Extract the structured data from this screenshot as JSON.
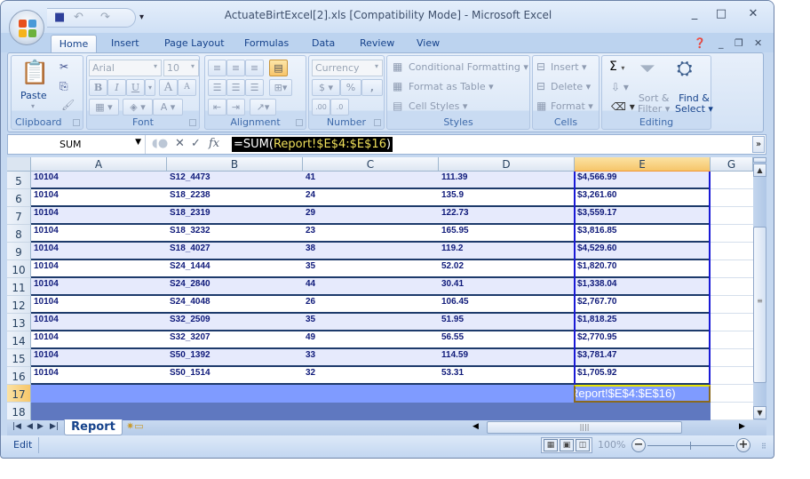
{
  "window": {
    "title": "ActuateBirtExcel[2].xls  [Compatibility Mode] - Microsoft Excel",
    "minimize_glyph": "_",
    "maximize_glyph": "□",
    "close_glyph": "✕"
  },
  "qat": {
    "save_icon": "save-icon",
    "undo_glyph": "↶",
    "redo_glyph": "↷",
    "customize_glyph": "⇟"
  },
  "tabs": [
    "Home",
    "Insert",
    "Page Layout",
    "Formulas",
    "Data",
    "Review",
    "View"
  ],
  "tabs_active": "Home",
  "ribbon": {
    "clipboard": {
      "label": "Clipboard",
      "paste": "Paste"
    },
    "font": {
      "label": "Font",
      "font_name": "Arial",
      "font_size": "10",
      "bold": "B",
      "italic": "I",
      "underline": "U",
      "grow": "A",
      "shrink": "A",
      "font_color": "A"
    },
    "alignment": {
      "label": "Alignment"
    },
    "number": {
      "label": "Number",
      "format": "Currency",
      "currency": "$",
      "percent": "%",
      "comma": ",",
      "inc_decimal": ".00",
      "dec_decimal": ".0"
    },
    "styles": {
      "label": "Styles",
      "conditional": "Conditional Formatting",
      "format_table": "Format as Table",
      "cell_styles": "Cell Styles"
    },
    "cells": {
      "label": "Cells",
      "insert": "Insert",
      "delete": "Delete",
      "format": "Format"
    },
    "editing": {
      "label": "Editing",
      "sum": "Σ",
      "sort_filter_1": "Sort &",
      "sort_filter_2": "Filter",
      "find_select_1": "Find &",
      "find_select_2": "Select"
    }
  },
  "formula_bar": {
    "name_box": "SUM",
    "formula_prefix": "=SUM(",
    "formula_ref": "Report!$E$4:$E$16",
    "formula_suffix": ")"
  },
  "columns": [
    "A",
    "B",
    "C",
    "D",
    "E",
    "G"
  ],
  "selected_column": "E",
  "rows": [
    {
      "num": "5",
      "a": "10104",
      "b": "S12_4473",
      "c": "41",
      "d": "111.39",
      "e": "$4,566.99"
    },
    {
      "num": "6",
      "a": "10104",
      "b": "S18_2238",
      "c": "24",
      "d": "135.9",
      "e": "$3,261.60"
    },
    {
      "num": "7",
      "a": "10104",
      "b": "S18_2319",
      "c": "29",
      "d": "122.73",
      "e": "$3,559.17"
    },
    {
      "num": "8",
      "a": "10104",
      "b": "S18_3232",
      "c": "23",
      "d": "165.95",
      "e": "$3,816.85"
    },
    {
      "num": "9",
      "a": "10104",
      "b": "S18_4027",
      "c": "38",
      "d": "119.2",
      "e": "$4,529.60"
    },
    {
      "num": "10",
      "a": "10104",
      "b": "S24_1444",
      "c": "35",
      "d": "52.02",
      "e": "$1,820.70"
    },
    {
      "num": "11",
      "a": "10104",
      "b": "S24_2840",
      "c": "44",
      "d": "30.41",
      "e": "$1,338.04"
    },
    {
      "num": "12",
      "a": "10104",
      "b": "S24_4048",
      "c": "26",
      "d": "106.45",
      "e": "$2,767.70"
    },
    {
      "num": "13",
      "a": "10104",
      "b": "S32_2509",
      "c": "35",
      "d": "51.95",
      "e": "$1,818.25"
    },
    {
      "num": "14",
      "a": "10104",
      "b": "S32_3207",
      "c": "49",
      "d": "56.55",
      "e": "$2,770.95"
    },
    {
      "num": "15",
      "a": "10104",
      "b": "S50_1392",
      "c": "33",
      "d": "114.59",
      "e": "$3,781.47"
    },
    {
      "num": "16",
      "a": "10104",
      "b": "S50_1514",
      "c": "32",
      "d": "53.31",
      "e": "$1,705.92"
    }
  ],
  "row17": {
    "num": "17",
    "active_cell_text": "Report!$E$4:$E$16)"
  },
  "row18": {
    "num": "18"
  },
  "sheet_tabs": [
    "Report"
  ],
  "status": {
    "mode": "Edit",
    "zoom": "100%"
  },
  "colors": {
    "row_band": "#e6eafc",
    "row17": "#7f9bff",
    "row18": "#5f78c0",
    "cell_text": "#0f1a7a",
    "selection_border": "#1a1ad6"
  }
}
